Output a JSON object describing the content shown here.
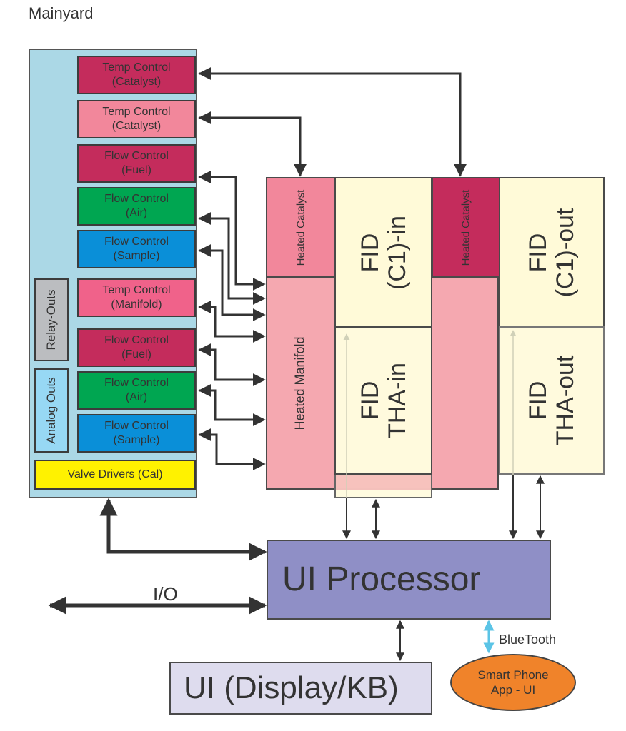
{
  "title": "Mainyard",
  "colors": {
    "panel": "#abd8e6",
    "catalyst_dark": "#c42c5c",
    "catalyst_light": "#f2879b",
    "flow_green": "#00a651",
    "flow_blue": "#0a8fd8",
    "manifold_pink": "#f0628a",
    "valve_yellow": "#fff200",
    "relay_gray": "#bbbdc0",
    "analog_blue": "#97d8f4",
    "heated_manifold": "#f5a8b0",
    "fid_cream": "#fffad8",
    "processor": "#8f8fc6",
    "display": "#dedcee",
    "phone": "#f0832a",
    "bluetooth": "#5bc4e6"
  },
  "mainyard": {
    "modules": [
      {
        "line1": "Temp Control",
        "line2": "(Catalyst)"
      },
      {
        "line1": "Temp Control",
        "line2": "(Catalyst)"
      },
      {
        "line1": "Flow Control",
        "line2": "(Fuel)"
      },
      {
        "line1": "Flow Control",
        "line2": "(Air)"
      },
      {
        "line1": "Flow Control",
        "line2": "(Sample)"
      },
      {
        "line1": "Temp Control",
        "line2": "(Manifold)"
      },
      {
        "line1": "Flow Control",
        "line2": "(Fuel)"
      },
      {
        "line1": "Flow Control",
        "line2": "(Air)"
      },
      {
        "line1": "Flow Control",
        "line2": "(Sample)"
      }
    ],
    "relay_outs": "Relay-Outs",
    "analog_outs": "Analog Outs",
    "valve_drivers": "Valve Drivers (Cal)"
  },
  "oven": {
    "heated_catalyst_1": "Heated Catalyst",
    "heated_catalyst_2": "Heated Catalyst",
    "heated_manifold": "Heated Manifold",
    "fid_c1_in": {
      "line1": "FID",
      "line2": "(C1)-in"
    },
    "fid_tha_in": {
      "line1": "FID",
      "line2": "THA-in"
    },
    "fid_c1_out": {
      "line1": "FID",
      "line2": "(C1)-out"
    },
    "fid_tha_out": {
      "line1": "FID",
      "line2": "THA-out"
    }
  },
  "processor": "UI Processor",
  "io_label": "I/O",
  "display": "UI (Display/KB)",
  "bluetooth_label": "BlueTooth",
  "phone": {
    "line1": "Smart Phone",
    "line2": "App - UI"
  }
}
